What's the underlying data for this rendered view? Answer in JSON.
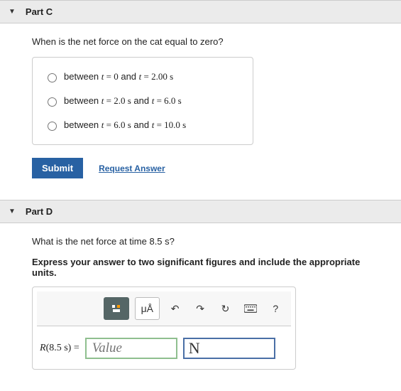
{
  "partC": {
    "title": "Part C",
    "question": "When is the net force on the cat equal to zero?",
    "choices": [
      {
        "pre": "between ",
        "t1": "t",
        "eq1": " = 0",
        "mid": " and ",
        "t2": "t",
        "eq2": " = 2.00 s"
      },
      {
        "pre": "between ",
        "t1": "t",
        "eq1": " = 2.0 s",
        "mid": " and ",
        "t2": "t",
        "eq2": " = 6.0 s"
      },
      {
        "pre": "between ",
        "t1": "t",
        "eq1": " = 6.0 s",
        "mid": " and ",
        "t2": "t",
        "eq2": " = 10.0 s"
      }
    ],
    "submit": "Submit",
    "request": "Request Answer"
  },
  "partD": {
    "title": "Part D",
    "question": "What is the net force at time 8.5 s?",
    "instruction": "Express your answer to two significant figures and include the appropriate units.",
    "toolbar": {
      "units_label": "μÅ",
      "help": "?"
    },
    "lhs": "R(8.5 s) = ",
    "value_placeholder": "Value",
    "unit_value": "N"
  }
}
